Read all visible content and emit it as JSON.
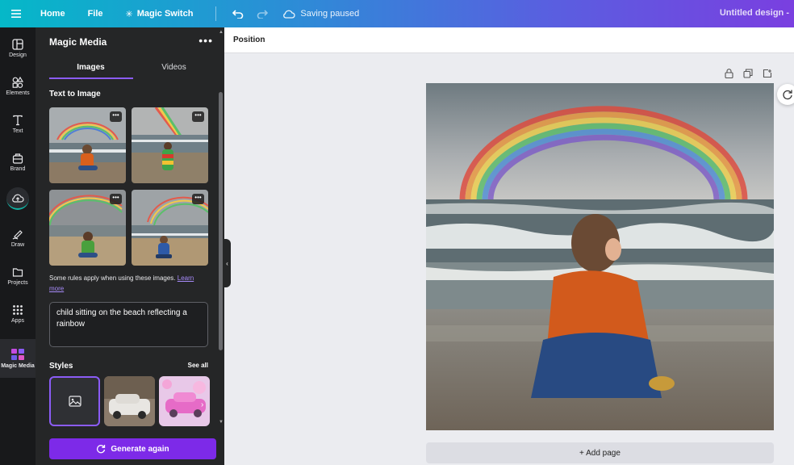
{
  "topbar": {
    "home": "Home",
    "file": "File",
    "magic_switch": "Magic Switch",
    "save_status": "Saving paused",
    "doc_title": "Untitled design -"
  },
  "rail": {
    "items": [
      {
        "label": "Design",
        "icon": "layout-icon"
      },
      {
        "label": "Elements",
        "icon": "shapes-icon"
      },
      {
        "label": "Text",
        "icon": "text-icon"
      },
      {
        "label": "Brand",
        "icon": "brand-icon"
      },
      {
        "label": "",
        "icon": "upload-cloud-icon"
      },
      {
        "label": "Draw",
        "icon": "draw-icon"
      },
      {
        "label": "Projects",
        "icon": "folder-icon"
      },
      {
        "label": "Apps",
        "icon": "apps-grid-icon"
      },
      {
        "label": "Magic Media",
        "icon": "magic-media-icon"
      }
    ]
  },
  "panel": {
    "title": "Magic Media",
    "more": "•••",
    "tabs": [
      "Images",
      "Videos"
    ],
    "section_title": "Text to Image",
    "thumb_more": "•••",
    "rules_text": "Some rules apply when using these images. ",
    "rules_link_1": "Learn",
    "rules_link_2": "more",
    "prompt": "child sitting on the beach reflecting a rainbow",
    "styles_title": "Styles",
    "see_all": "See all",
    "generate": "Generate again",
    "accent": "#7d2ae8"
  },
  "editor": {
    "toolbar_position": "Position",
    "add_page": "+ Add page"
  }
}
